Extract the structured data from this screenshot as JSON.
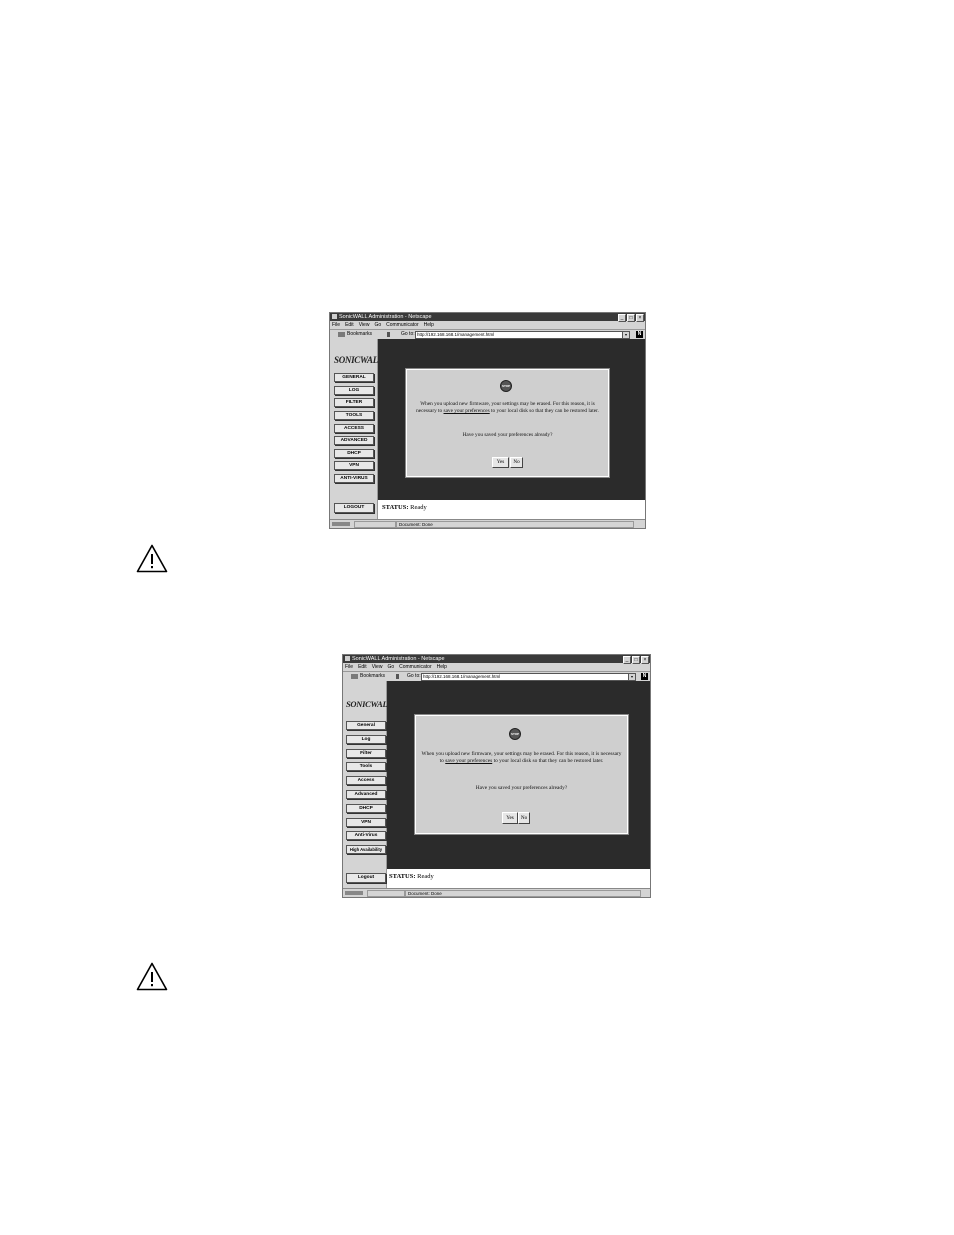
{
  "screenshots": [
    {
      "window_title": "SonicWALL Administration - Netscape",
      "menu": [
        "File",
        "Edit",
        "View",
        "Go",
        "Communicator",
        "Help"
      ],
      "bookmarks_label": "Bookmarks",
      "goto_label": "Go to:",
      "url": "http://192.168.168.1/management.html",
      "logo_text": "SONICWALL",
      "nav_items": [
        "GENERAL",
        "LOG",
        "FILTER",
        "TOOLS",
        "ACCESS",
        "ADVANCED",
        "DHCP",
        "VPN",
        "ANTI-VIRUS"
      ],
      "stop_label": "STOP",
      "dialog_text_before_link": "When you upload new firmware, your settings may be erased. For this reason, it is necessary to",
      "dialog_link": "save your preferences",
      "dialog_text_after_link": "to your local disk so that they can be restored later.",
      "dialog_question": "Have you saved your preferences already?",
      "yes_label": "Yes",
      "no_label": "No",
      "logout_label": "LOGOUT",
      "status_label": "STATUS:",
      "status_value": "Ready",
      "bottom_status": "Document: Done"
    },
    {
      "window_title": "SonicWALL Administration - Netscape",
      "menu": [
        "File",
        "Edit",
        "View",
        "Go",
        "Communicator",
        "Help"
      ],
      "bookmarks_label": "Bookmarks",
      "goto_label": "Go to:",
      "url": "http://192.168.168.1/management.html",
      "logo_text": "SONICWALL",
      "nav_items": [
        "General",
        "Log",
        "Filter",
        "Tools",
        "Access",
        "Advanced",
        "DHCP",
        "VPN",
        "Anti-Virus",
        "High Availability"
      ],
      "stop_label": "STOP",
      "dialog_text_before_link": "When you upload new firmware, your settings may be erased. For this reason, it is necessary to",
      "dialog_link": "save your preferences",
      "dialog_text_after_link": "to your local disk so that they can be restored later.",
      "dialog_question": "Have you saved your preferences already?",
      "yes_label": "Yes",
      "no_label": "No",
      "logout_label": "Logout",
      "status_label": "STATUS:",
      "status_value": "Ready",
      "bottom_status": "Document: Done"
    }
  ]
}
